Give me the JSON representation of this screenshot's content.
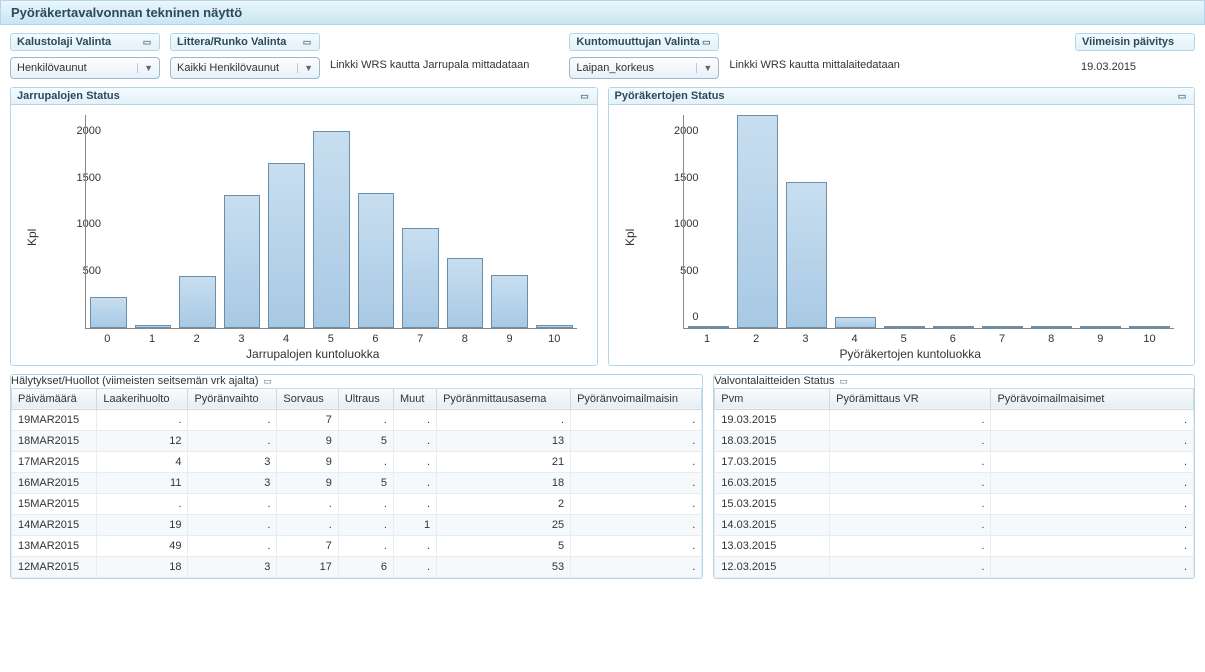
{
  "header": {
    "title": "Pyöräkertavalvonnan tekninen näyttö"
  },
  "controls": {
    "kalustolaji": {
      "label": "Kalustolaji Valinta",
      "value": "Henkilövaunut"
    },
    "littera": {
      "label": "Littera/Runko Valinta",
      "value": "Kaikki Henkilövaunut"
    },
    "kuntomuuttuja": {
      "label": "Kuntomuuttujan Valinta",
      "value": "Laipan_korkeus"
    },
    "link_jarrupala": "Linkki WRS kautta Jarrupala mittadataan",
    "link_mittalaite": "Linkki WRS kautta mittalaitedataan",
    "viimeisin": {
      "label": "Viimeisin päivitys",
      "value": "19.03.2015"
    }
  },
  "chart_data": [
    {
      "type": "bar",
      "title": "Jarrupalojen Status",
      "ylabel": "Kpl",
      "xlabel": "Jarrupalojen kuntoluokka",
      "ylim": [
        0,
        2000
      ],
      "yticks": [
        0,
        500,
        1000,
        1500,
        2000
      ],
      "categories": [
        "0",
        "1",
        "2",
        "3",
        "4",
        "5",
        "6",
        "7",
        "8",
        "9",
        "10"
      ],
      "values": [
        290,
        30,
        490,
        1250,
        1550,
        1850,
        1270,
        940,
        660,
        500,
        30
      ]
    },
    {
      "type": "bar",
      "title": "Pyöräkertojen Status",
      "ylabel": "Kpl",
      "xlabel": "Pyöräkertojen kuntoluokka",
      "ylim": [
        0,
        2000
      ],
      "yticks": [
        0,
        500,
        1000,
        1500,
        2000
      ],
      "categories": [
        "1",
        "2",
        "3",
        "4",
        "5",
        "6",
        "7",
        "8",
        "9",
        "10"
      ],
      "values": [
        20,
        2050,
        1370,
        100,
        10,
        0,
        0,
        0,
        0,
        0
      ]
    }
  ],
  "alerts_table": {
    "title": "Hälytykset/Huollot (viimeisten seitsemän  vrk ajalta)",
    "columns": [
      "Päivämäärä",
      "Laakerihuolto",
      "Pyöränvaihto",
      "Sorvaus",
      "Ultraus",
      "Muut",
      "Pyöränmittausasema",
      "Pyöränvoimailmaisin"
    ],
    "rows": [
      [
        "19MAR2015",
        ".",
        ".",
        "7",
        ".",
        ".",
        ".",
        "."
      ],
      [
        "18MAR2015",
        "12",
        ".",
        "9",
        "5",
        ".",
        "13",
        "."
      ],
      [
        "17MAR2015",
        "4",
        "3",
        "9",
        ".",
        ".",
        "21",
        "."
      ],
      [
        "16MAR2015",
        "11",
        "3",
        "9",
        "5",
        ".",
        "18",
        "."
      ],
      [
        "15MAR2015",
        ".",
        ".",
        ".",
        ".",
        ".",
        "2",
        "."
      ],
      [
        "14MAR2015",
        "19",
        ".",
        ".",
        ".",
        "1",
        "25",
        "."
      ],
      [
        "13MAR2015",
        "49",
        ".",
        "7",
        ".",
        ".",
        "5",
        "."
      ],
      [
        "12MAR2015",
        "18",
        "3",
        "17",
        "6",
        ".",
        "53",
        "."
      ]
    ]
  },
  "status_table": {
    "title": "Valvontalaitteiden Status",
    "columns": [
      "Pvm",
      "Pyörämittaus VR",
      "Pyörävoimailmaisimet"
    ],
    "rows": [
      [
        "19.03.2015",
        ".",
        "."
      ],
      [
        "18.03.2015",
        ".",
        "."
      ],
      [
        "17.03.2015",
        ".",
        "."
      ],
      [
        "16.03.2015",
        ".",
        "."
      ],
      [
        "15.03.2015",
        ".",
        "."
      ],
      [
        "14.03.2015",
        ".",
        "."
      ],
      [
        "13.03.2015",
        ".",
        "."
      ],
      [
        "12.03.2015",
        ".",
        "."
      ]
    ]
  }
}
